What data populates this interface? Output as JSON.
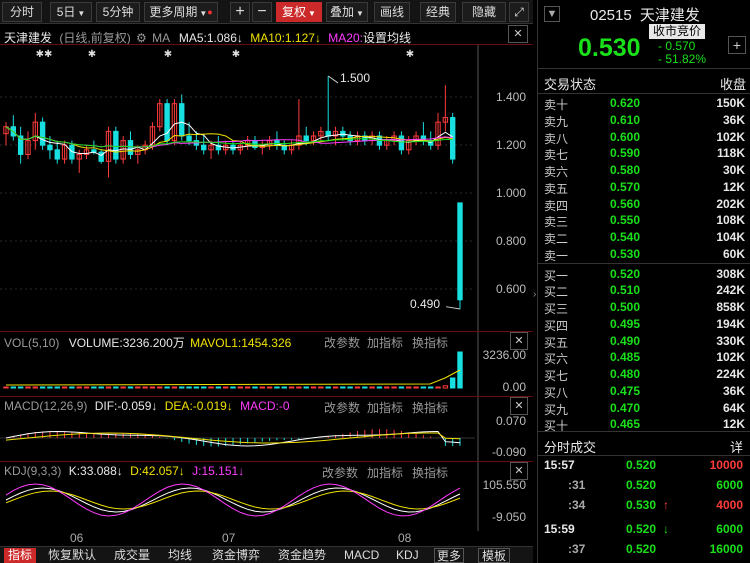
{
  "toolbar": {
    "fenshi": "分时",
    "day5": "5日",
    "min5": "5分钟",
    "more_period": "更多周期",
    "plus": "+",
    "minus": "−",
    "fuquan": "复权",
    "diejia": "叠加",
    "huaxian": "画线",
    "jingdian": "经典",
    "yincang": "隐藏"
  },
  "kline": {
    "name": "天津建发",
    "mode": "(日线,前复权)",
    "ma": "MA",
    "ma5": "MA5:1.086",
    "ma10": "MA10:1.127",
    "ma20": "MA20:",
    "ma20_setting": "设置均线",
    "high_label": "1.500",
    "low_label": "0.490",
    "y_ticks": [
      "1.400",
      "1.200",
      "1.000",
      "0.800",
      "0.600"
    ],
    "candles": [
      {
        "o": 1.25,
        "h": 1.3,
        "l": 1.2,
        "c": 1.28
      },
      {
        "o": 1.28,
        "h": 1.33,
        "l": 1.22,
        "c": 1.24
      },
      {
        "o": 1.24,
        "h": 1.28,
        "l": 1.12,
        "c": 1.16
      },
      {
        "o": 1.16,
        "h": 1.26,
        "l": 1.14,
        "c": 1.22
      },
      {
        "o": 1.22,
        "h": 1.34,
        "l": 1.18,
        "c": 1.3
      },
      {
        "o": 1.3,
        "h": 1.32,
        "l": 1.18,
        "c": 1.2
      },
      {
        "o": 1.2,
        "h": 1.24,
        "l": 1.14,
        "c": 1.18
      },
      {
        "o": 1.18,
        "h": 1.22,
        "l": 1.12,
        "c": 1.14
      },
      {
        "o": 1.14,
        "h": 1.22,
        "l": 1.12,
        "c": 1.2
      },
      {
        "o": 1.2,
        "h": 1.22,
        "l": 1.12,
        "c": 1.14
      },
      {
        "o": 1.14,
        "h": 1.18,
        "l": 1.08,
        "c": 1.16
      },
      {
        "o": 1.16,
        "h": 1.2,
        "l": 1.14,
        "c": 1.18
      },
      {
        "o": 1.18,
        "h": 1.22,
        "l": 1.16,
        "c": 1.17
      },
      {
        "o": 1.17,
        "h": 1.18,
        "l": 1.12,
        "c": 1.13
      },
      {
        "o": 1.13,
        "h": 1.28,
        "l": 1.06,
        "c": 1.26
      },
      {
        "o": 1.26,
        "h": 1.28,
        "l": 1.12,
        "c": 1.14
      },
      {
        "o": 1.14,
        "h": 1.24,
        "l": 1.12,
        "c": 1.22
      },
      {
        "o": 1.22,
        "h": 1.26,
        "l": 1.14,
        "c": 1.16
      },
      {
        "o": 1.16,
        "h": 1.2,
        "l": 1.12,
        "c": 1.18
      },
      {
        "o": 1.18,
        "h": 1.22,
        "l": 1.16,
        "c": 1.2
      },
      {
        "o": 1.2,
        "h": 1.3,
        "l": 1.18,
        "c": 1.28
      },
      {
        "o": 1.28,
        "h": 1.4,
        "l": 1.26,
        "c": 1.38
      },
      {
        "o": 1.38,
        "h": 1.4,
        "l": 1.2,
        "c": 1.22
      },
      {
        "o": 1.22,
        "h": 1.4,
        "l": 1.2,
        "c": 1.38
      },
      {
        "o": 1.38,
        "h": 1.42,
        "l": 1.22,
        "c": 1.24
      },
      {
        "o": 1.24,
        "h": 1.3,
        "l": 1.2,
        "c": 1.22
      },
      {
        "o": 1.22,
        "h": 1.26,
        "l": 1.18,
        "c": 1.2
      },
      {
        "o": 1.2,
        "h": 1.24,
        "l": 1.16,
        "c": 1.18
      },
      {
        "o": 1.18,
        "h": 1.22,
        "l": 1.14,
        "c": 1.2
      },
      {
        "o": 1.2,
        "h": 1.24,
        "l": 1.16,
        "c": 1.18
      },
      {
        "o": 1.18,
        "h": 1.22,
        "l": 1.16,
        "c": 1.2
      },
      {
        "o": 1.2,
        "h": 1.22,
        "l": 1.16,
        "c": 1.18
      },
      {
        "o": 1.18,
        "h": 1.22,
        "l": 1.16,
        "c": 1.2
      },
      {
        "o": 1.2,
        "h": 1.24,
        "l": 1.18,
        "c": 1.22
      },
      {
        "o": 1.22,
        "h": 1.24,
        "l": 1.18,
        "c": 1.19
      },
      {
        "o": 1.19,
        "h": 1.22,
        "l": 1.16,
        "c": 1.2
      },
      {
        "o": 1.2,
        "h": 1.24,
        "l": 1.18,
        "c": 1.22
      },
      {
        "o": 1.22,
        "h": 1.26,
        "l": 1.18,
        "c": 1.2
      },
      {
        "o": 1.2,
        "h": 1.22,
        "l": 1.16,
        "c": 1.18
      },
      {
        "o": 1.18,
        "h": 1.22,
        "l": 1.16,
        "c": 1.2
      },
      {
        "o": 1.2,
        "h": 1.4,
        "l": 1.18,
        "c": 1.24
      },
      {
        "o": 1.24,
        "h": 1.28,
        "l": 1.2,
        "c": 1.22
      },
      {
        "o": 1.22,
        "h": 1.26,
        "l": 1.2,
        "c": 1.24
      },
      {
        "o": 1.24,
        "h": 1.28,
        "l": 1.22,
        "c": 1.26
      },
      {
        "o": 1.26,
        "h": 1.5,
        "l": 1.22,
        "c": 1.24
      },
      {
        "o": 1.24,
        "h": 1.28,
        "l": 1.2,
        "c": 1.26
      },
      {
        "o": 1.26,
        "h": 1.28,
        "l": 1.22,
        "c": 1.24
      },
      {
        "o": 1.24,
        "h": 1.26,
        "l": 1.2,
        "c": 1.22
      },
      {
        "o": 1.22,
        "h": 1.26,
        "l": 1.2,
        "c": 1.24
      },
      {
        "o": 1.24,
        "h": 1.26,
        "l": 1.2,
        "c": 1.22
      },
      {
        "o": 1.22,
        "h": 1.26,
        "l": 1.2,
        "c": 1.24
      },
      {
        "o": 1.24,
        "h": 1.26,
        "l": 1.18,
        "c": 1.2
      },
      {
        "o": 1.2,
        "h": 1.24,
        "l": 1.18,
        "c": 1.22
      },
      {
        "o": 1.22,
        "h": 1.26,
        "l": 1.2,
        "c": 1.24
      },
      {
        "o": 1.24,
        "h": 1.26,
        "l": 1.16,
        "c": 1.18
      },
      {
        "o": 1.18,
        "h": 1.24,
        "l": 1.16,
        "c": 1.22
      },
      {
        "o": 1.22,
        "h": 1.26,
        "l": 1.2,
        "c": 1.24
      },
      {
        "o": 1.24,
        "h": 1.3,
        "l": 1.2,
        "c": 1.22
      },
      {
        "o": 1.22,
        "h": 1.26,
        "l": 1.18,
        "c": 1.2
      },
      {
        "o": 1.2,
        "h": 1.34,
        "l": 1.18,
        "c": 1.3
      },
      {
        "o": 1.3,
        "h": 1.46,
        "l": 1.26,
        "c": 1.32
      },
      {
        "o": 1.32,
        "h": 1.34,
        "l": 1.12,
        "c": 1.14
      },
      {
        "o": 0.95,
        "h": 0.95,
        "l": 0.49,
        "c": 0.53
      }
    ]
  },
  "vol": {
    "label": "VOL(5,10)",
    "volume": "VOLUME:3236.200万",
    "mavol": "MAVOL1:1454.326",
    "change_param": "改参数",
    "add_indicator": "加指标",
    "switch_indicator": "换指标",
    "y_top": "3236.00",
    "y_bottom": "0.00",
    "values": [
      40,
      30,
      55,
      35,
      45,
      30,
      25,
      30,
      28,
      26,
      35,
      30,
      25,
      28,
      60,
      35,
      30,
      28,
      25,
      26,
      30,
      50,
      45,
      40,
      38,
      30,
      28,
      26,
      30,
      28,
      26,
      25,
      28,
      30,
      26,
      28,
      30,
      26,
      25,
      28,
      45,
      30,
      28,
      30,
      60,
      30,
      28,
      26,
      28,
      26,
      28,
      30,
      28,
      26,
      30,
      28,
      30,
      35,
      30,
      40,
      200,
      900,
      3236
    ]
  },
  "macd": {
    "label": "MACD(12,26,9)",
    "dif": "DIF:-0.059",
    "dea": "DEA:-0.019",
    "macd": "MACD:-0",
    "change_param": "改参数",
    "add_indicator": "加指标",
    "switch_indicator": "换指标",
    "y_top": "0.070",
    "y_bottom": "-0.090"
  },
  "kdj": {
    "label": "KDJ(9,3,3)",
    "k": "K:33.088",
    "d": "D:42.057",
    "j": "J:15.151",
    "change_param": "改参数",
    "add_indicator": "加指标",
    "switch_indicator": "换指标",
    "y_top": "105.550",
    "y_bottom": "-9.050"
  },
  "x_labels": [
    "06",
    "07",
    "08"
  ],
  "bottom_tabs": [
    "指标",
    "恢复默认",
    "成交量",
    "均线",
    "资金博弈",
    "资金趋势",
    "MACD",
    "KDJ",
    "更多",
    "模板"
  ],
  "quote": {
    "code": "02515",
    "name": "天津建发",
    "price": "0.530",
    "status": "收市竞价",
    "change": "- 0.570",
    "pct": "- 51.82%",
    "section_title": "交易状态",
    "section_value": "收盘"
  },
  "asks": [
    {
      "label": "卖十",
      "price": "0.620",
      "vol": "150K"
    },
    {
      "label": "卖九",
      "price": "0.610",
      "vol": "36K"
    },
    {
      "label": "卖八",
      "price": "0.600",
      "vol": "102K"
    },
    {
      "label": "卖七",
      "price": "0.590",
      "vol": "118K"
    },
    {
      "label": "卖六",
      "price": "0.580",
      "vol": "30K"
    },
    {
      "label": "卖五",
      "price": "0.570",
      "vol": "12K"
    },
    {
      "label": "卖四",
      "price": "0.560",
      "vol": "202K"
    },
    {
      "label": "卖三",
      "price": "0.550",
      "vol": "108K"
    },
    {
      "label": "卖二",
      "price": "0.540",
      "vol": "104K"
    },
    {
      "label": "卖一",
      "price": "0.530",
      "vol": "60K"
    }
  ],
  "bids": [
    {
      "label": "买一",
      "price": "0.520",
      "vol": "308K"
    },
    {
      "label": "买二",
      "price": "0.510",
      "vol": "242K"
    },
    {
      "label": "买三",
      "price": "0.500",
      "vol": "858K"
    },
    {
      "label": "买四",
      "price": "0.495",
      "vol": "194K"
    },
    {
      "label": "买五",
      "price": "0.490",
      "vol": "330K"
    },
    {
      "label": "买六",
      "price": "0.485",
      "vol": "102K"
    },
    {
      "label": "买七",
      "price": "0.480",
      "vol": "224K"
    },
    {
      "label": "买八",
      "price": "0.475",
      "vol": "36K"
    },
    {
      "label": "买九",
      "price": "0.470",
      "vol": "64K"
    },
    {
      "label": "买十",
      "price": "0.465",
      "vol": "12K"
    }
  ],
  "trades": {
    "title": "分时成交",
    "detail": "详",
    "rows": [
      {
        "time": "15:57",
        "price": "0.520",
        "arrow": "",
        "vol": "10000"
      },
      {
        "time": ":31",
        "price": "0.520",
        "arrow": "",
        "vol": "6000"
      },
      {
        "time": ":34",
        "price": "0.530",
        "arrow": "↑",
        "vol": "4000"
      },
      {
        "time": "15:59",
        "price": "0.520",
        "arrow": "↓",
        "vol": "6000"
      },
      {
        "time": ":37",
        "price": "0.520",
        "arrow": "",
        "vol": "16000"
      }
    ]
  },
  "colors": {
    "up": "#ff3b3b",
    "down": "#19e0e0",
    "ma5": "#ffffff",
    "ma10": "#f0e000",
    "ma20": "#ff3cff",
    "ma60": "#19e019"
  }
}
